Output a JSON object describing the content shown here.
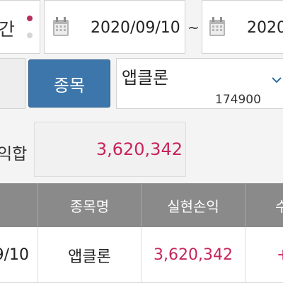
{
  "filters": {
    "period_label": "간",
    "date_from": "2020/09/10",
    "date_separator": "~",
    "date_to": "2020/"
  },
  "stock": {
    "button_label": "종목",
    "selected_name": "앱클론",
    "selected_code": "174900"
  },
  "summary": {
    "total_label": "익합",
    "total_value": "3,620,342"
  },
  "table": {
    "headers": [
      "",
      "종목명",
      "실현손익",
      "수"
    ],
    "rows": [
      {
        "date": "9/10",
        "name": "앱클론",
        "profit": "3,620,342",
        "rate": "+"
      }
    ]
  },
  "colors": {
    "accent_blue": "#3d76aa",
    "profit_red": "#c8245a",
    "header_gray": "#8a8a8a",
    "dot_active": "#b8305a"
  },
  "icons": {
    "date_picker": "calendar-icon",
    "dropdown": "chevron-down-icon"
  }
}
